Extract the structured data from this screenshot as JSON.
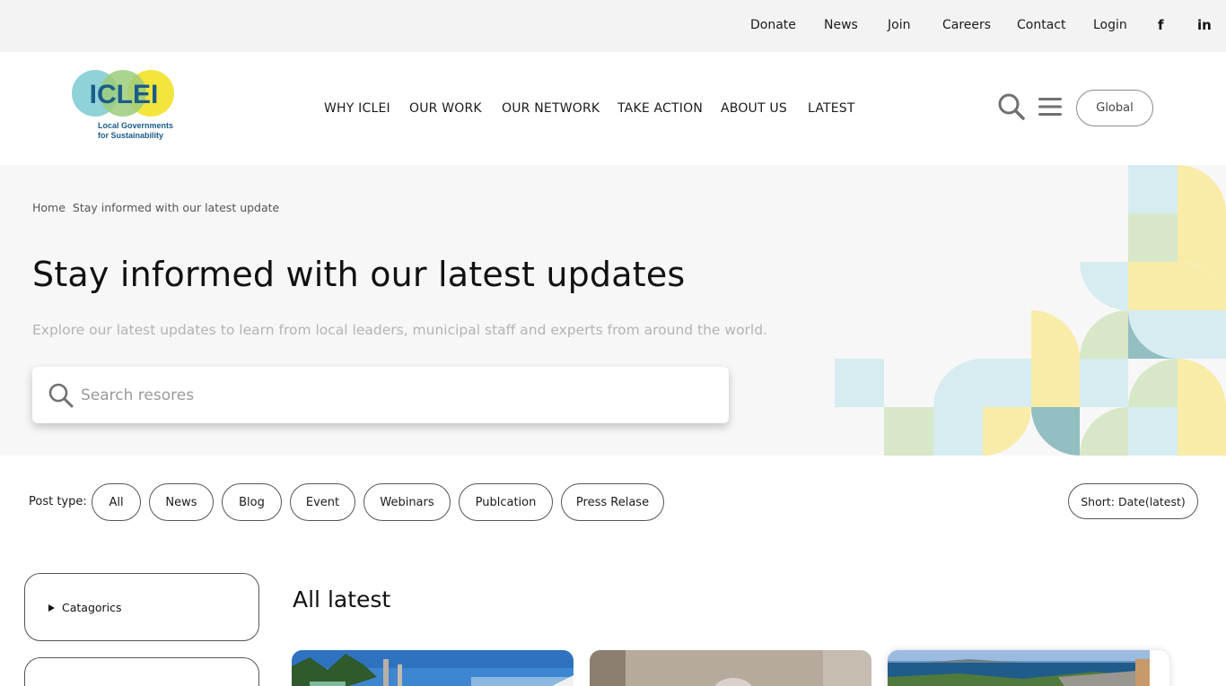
{
  "topbar": {
    "links": [
      "Donate",
      "News",
      "Join",
      "Careers",
      "Contact",
      "Login"
    ],
    "social": {
      "facebook": "f",
      "linkedin": "in"
    }
  },
  "header": {
    "logo": {
      "wordmark": "ICLEI",
      "tagline_line1": "Local Governments",
      "tagline_line2": "for Sustainability"
    },
    "nav": [
      "WHY ICLEI",
      "OUR WORK",
      "OUR NETWORK",
      "TAKE ACTION",
      "ABOUT US",
      "LATEST"
    ],
    "region_button": "Global",
    "icons": {
      "search": "search-icon",
      "menu": "hamburger-menu-icon"
    }
  },
  "hero": {
    "breadcrumb": {
      "home": "Home",
      "current": "Stay informed with our latest update"
    },
    "title": "Stay informed with our latest updates",
    "subtitle": "Explore our latest updates to learn from local leaders, municipal staff and experts from around the world.",
    "search_placeholder": "Search resores"
  },
  "filters": {
    "label": "Post type:",
    "types": [
      "All",
      "News",
      "Blog",
      "Event",
      "Webinars",
      "Publcation",
      "Press Relase"
    ],
    "sort": "Short: Date(latest)"
  },
  "sidebar": {
    "categories": "Catagorics"
  },
  "main": {
    "section_title": "All latest"
  },
  "colors": {
    "topbar_bg": "#f3f3f3",
    "hero_bg": "#f7f7f7",
    "pattern_blue": "#d6ecf1",
    "pattern_yellow": "#f8eca8",
    "pattern_green": "#d6e8c8",
    "pattern_teal": "#93bec2",
    "logo_blue": "#8fd3d8",
    "logo_yellow": "#f4e53c",
    "logo_green": "#9ccc7a",
    "logo_text": "#1a5c8a"
  }
}
